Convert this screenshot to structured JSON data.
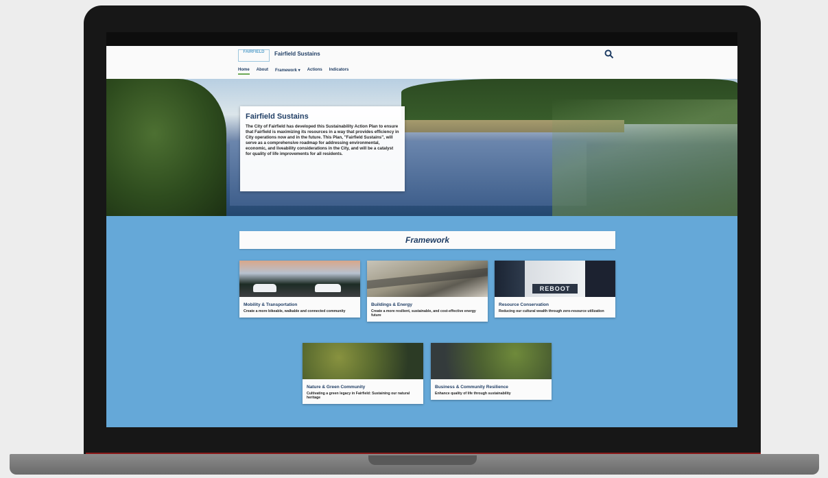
{
  "site": {
    "logo_text": "FAIRFIELD",
    "title": "Fairfield Sustains",
    "nav": [
      "Home",
      "About",
      "Framework ▾",
      "Actions",
      "Indicators"
    ]
  },
  "hero": {
    "title": "Fairfield Sustains",
    "text": "The City of Fairfield has developed this Sustainability Action Plan to ensure that Fairfield is maximizing its resources in a way that provides efficiency in City operations now and in the future. This Plan, \"Fairfield Sustains\", will serve as a comprehensive roadmap for addressing environmental, economic, and liveability considerations in the City, and will be a catalyst for quality of life improvements for all residents."
  },
  "framework": {
    "heading": "Framework",
    "cards": [
      {
        "title": "Mobility & Transportation",
        "desc": "Create a more bikeable, walkable and connected community"
      },
      {
        "title": "Buildings & Energy",
        "desc": "Create a more resilient, sustainable, and cost-effective energy future"
      },
      {
        "title": "Resource Conservation",
        "desc": "Reducing our cultural wealth through zero-resource utilization",
        "sign": "REBOOT"
      },
      {
        "title": "Nature & Green Community",
        "desc": "Cultivating a green legacy in Fairfield: Sustaining our natural heritage"
      },
      {
        "title": "Business & Community Resilience",
        "desc": "Enhance quality of life through sustainability"
      }
    ]
  },
  "colors": {
    "accent_blue": "#65a8d8",
    "title_navy": "#1f3d64",
    "nav_active": "#6ca956"
  },
  "icons": {
    "search": "search-icon"
  }
}
